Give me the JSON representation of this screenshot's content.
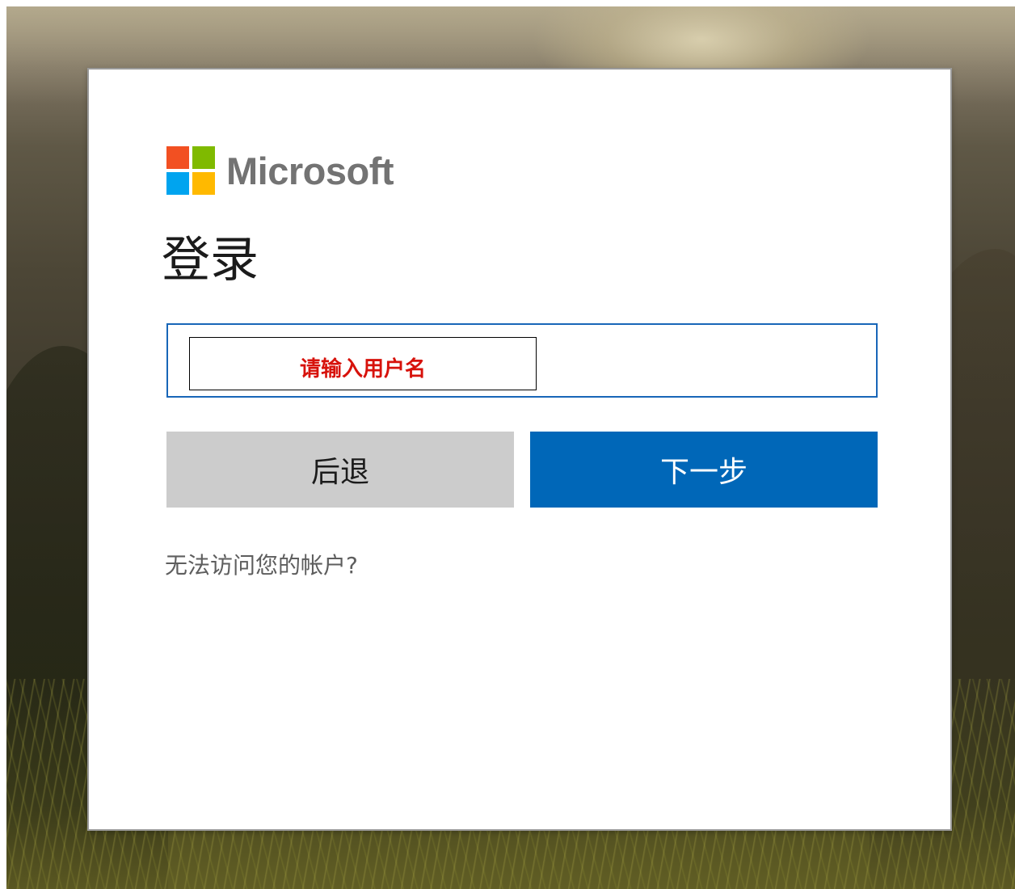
{
  "brand": {
    "name": "Microsoft",
    "logo_icon": "microsoft-logo-icon",
    "colors": {
      "red": "#f25022",
      "green": "#7fba00",
      "blue": "#00a4ef",
      "yellow": "#ffb900"
    }
  },
  "signin": {
    "title": "登录",
    "username_placeholder": "请输入用户名",
    "username_value": "",
    "back_label": "后退",
    "next_label": "下一步",
    "help_link": "无法访问您的帐户?"
  },
  "theme": {
    "accent": "#0067b8",
    "field_border": "#1866b8",
    "back_button_bg": "#cccccc",
    "placeholder_color": "#d7120b",
    "help_text": "#5e5e5e"
  }
}
